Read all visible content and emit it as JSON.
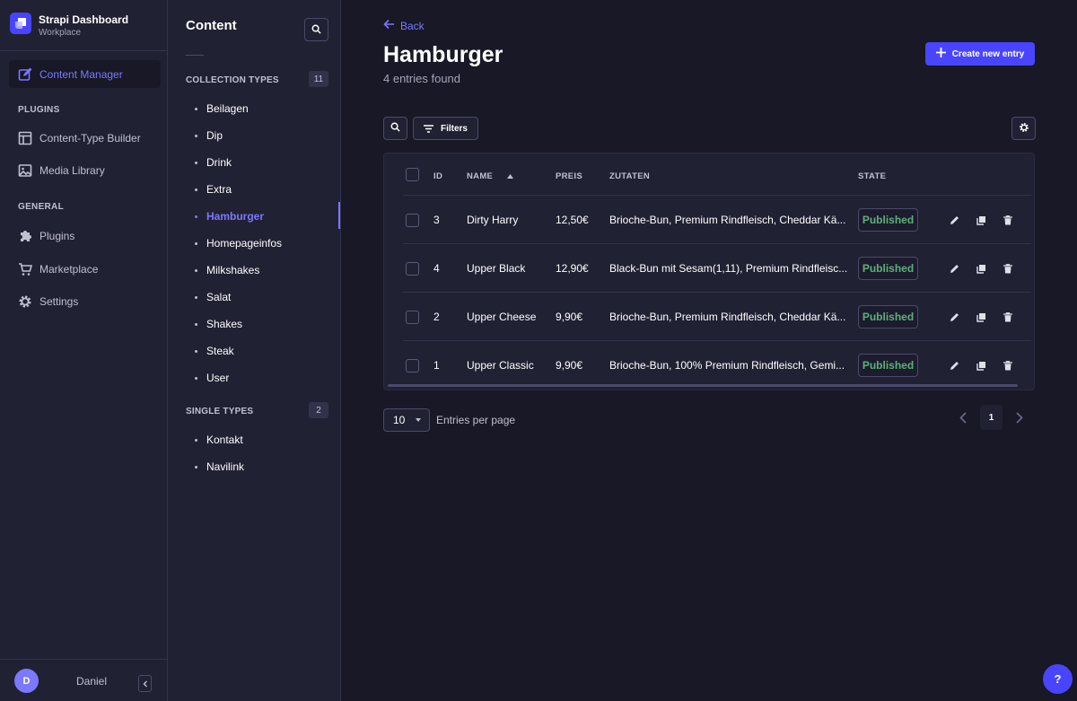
{
  "brand": {
    "title": "Strapi Dashboard",
    "subtitle": "Workplace"
  },
  "leftnav": {
    "active_item": {
      "label": "Content Manager",
      "icon": "pencil-square-icon"
    },
    "sections": [
      {
        "label": "PLUGINS",
        "items": [
          {
            "label": "Content-Type Builder",
            "icon": "layout-icon"
          },
          {
            "label": "Media Library",
            "icon": "image-icon"
          }
        ]
      },
      {
        "label": "GENERAL",
        "items": [
          {
            "label": "Plugins",
            "icon": "puzzle-icon"
          },
          {
            "label": "Marketplace",
            "icon": "cart-icon"
          },
          {
            "label": "Settings",
            "icon": "gear-icon"
          }
        ]
      }
    ],
    "user": {
      "initial": "D",
      "name": "Daniel"
    }
  },
  "subnav": {
    "title": "Content",
    "collection_types": {
      "label": "COLLECTION TYPES",
      "count": "11",
      "items": [
        "Beilagen",
        "Dip",
        "Drink",
        "Extra",
        "Hamburger",
        "Homepageinfos",
        "Milkshakes",
        "Salat",
        "Shakes",
        "Steak",
        "User"
      ],
      "active": "Hamburger"
    },
    "single_types": {
      "label": "SINGLE TYPES",
      "count": "2",
      "items": [
        "Kontakt",
        "Navilink"
      ]
    }
  },
  "main": {
    "back_label": "Back",
    "title": "Hamburger",
    "subtitle": "4 entries found",
    "create_label": "Create new entry",
    "filters_label": "Filters",
    "table": {
      "headers": {
        "id": "ID",
        "name": "NAME",
        "preis": "PREIS",
        "zutaten": "ZUTATEN",
        "state": "STATE"
      },
      "sort_column": "NAME",
      "rows": [
        {
          "id": "3",
          "name": "Dirty Harry",
          "preis": "12,50€",
          "zutaten": "Brioche-Bun, Premium Rindfleisch, Cheddar Kä...",
          "state": "Published"
        },
        {
          "id": "4",
          "name": "Upper Black",
          "preis": "12,90€",
          "zutaten": "Black-Bun mit Sesam(1,11), Premium Rindfleisc...",
          "state": "Published"
        },
        {
          "id": "2",
          "name": "Upper Cheese",
          "preis": "9,90€",
          "zutaten": "Brioche-Bun, Premium Rindfleisch, Cheddar Kä...",
          "state": "Published"
        },
        {
          "id": "1",
          "name": "Upper Classic",
          "preis": "9,90€",
          "zutaten": "Brioche-Bun, 100% Premium Rindfleisch, Gemi...",
          "state": "Published"
        }
      ]
    },
    "pagination": {
      "per_page": "10",
      "per_page_label": "Entries per page",
      "current_page": "1"
    }
  },
  "colors": {
    "accent": "#4945ff",
    "accent_light": "#7b79ff",
    "published": "#5cb176",
    "background": "#181826",
    "panel": "#212134"
  },
  "help_label": "?"
}
